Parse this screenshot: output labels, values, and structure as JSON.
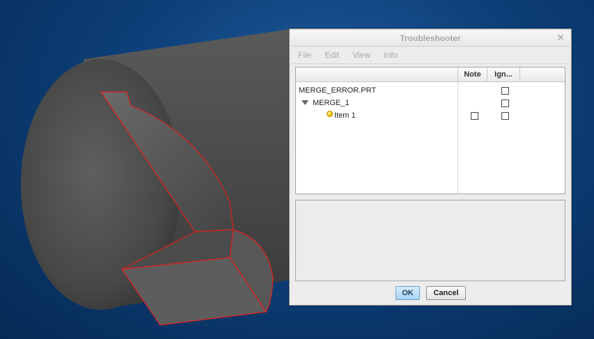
{
  "window": {
    "title": "Troubleshooter",
    "close_glyph": "×"
  },
  "menu": {
    "items": [
      "File",
      "Edit",
      "View",
      "Info"
    ]
  },
  "tree": {
    "columns": [
      "",
      "Note",
      "Ign..."
    ],
    "rows": [
      {
        "label": "MERGE_ERROR.PRT"
      },
      {
        "label": "MERGE_1"
      },
      {
        "label": "Item 1"
      }
    ]
  },
  "buttons": {
    "ok": "OK",
    "cancel": "Cancel"
  },
  "icons": {
    "expander": "triangle-down-icon",
    "status": "yellow-circle-icon",
    "close": "close-icon"
  },
  "colors": {
    "background": "#0d3f78",
    "model_face": "#555555",
    "edge_highlight": "#e02020",
    "status_dot": "#f5c400",
    "ok_button": "#a7d3f4"
  }
}
